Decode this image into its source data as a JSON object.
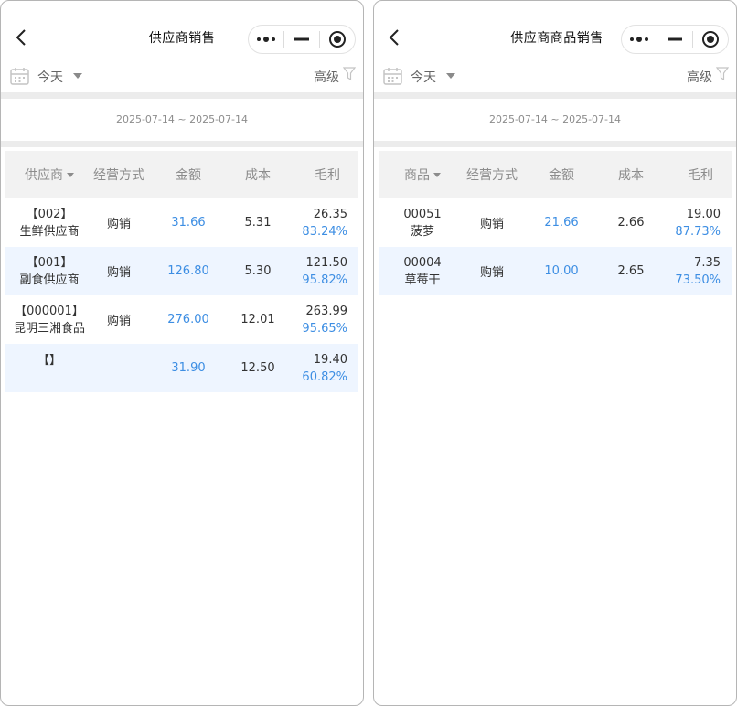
{
  "left": {
    "title": "供应商销售",
    "filter": {
      "period": "今天",
      "advanced": "高级"
    },
    "date_range": "2025-07-14 ~ 2025-07-14",
    "headers": [
      "供应商",
      "经营方式",
      "金额",
      "成本",
      "毛利"
    ],
    "rows": [
      {
        "code": "【002】",
        "name": "生鲜供应商",
        "mode": "购销",
        "amount": "31.66",
        "cost": "5.31",
        "profit": "26.35",
        "margin": "83.24%"
      },
      {
        "code": "【001】",
        "name": "副食供应商",
        "mode": "购销",
        "amount": "126.80",
        "cost": "5.30",
        "profit": "121.50",
        "margin": "95.82%"
      },
      {
        "code": "【000001】",
        "name": "昆明三湘食品",
        "mode": "购销",
        "amount": "276.00",
        "cost": "12.01",
        "profit": "263.99",
        "margin": "95.65%"
      },
      {
        "code": "【】",
        "name": "",
        "mode": "",
        "amount": "31.90",
        "cost": "12.50",
        "profit": "19.40",
        "margin": "60.82%"
      }
    ]
  },
  "right": {
    "title": "供应商商品销售",
    "filter": {
      "period": "今天",
      "advanced": "高级"
    },
    "date_range": "2025-07-14 ~ 2025-07-14",
    "headers": [
      "商品",
      "经营方式",
      "金额",
      "成本",
      "毛利"
    ],
    "rows": [
      {
        "code": "00051",
        "name": "菠萝",
        "mode": "购销",
        "amount": "21.66",
        "cost": "2.66",
        "profit": "19.00",
        "margin": "87.73%"
      },
      {
        "code": "00004",
        "name": "草莓干",
        "mode": "购销",
        "amount": "10.00",
        "cost": "2.65",
        "profit": "7.35",
        "margin": "73.50%"
      }
    ]
  },
  "colors": {
    "accent_blue": "#3d8ee3",
    "row_highlight": "#eef5ff",
    "header_bg": "#f2f2f2"
  },
  "icons": [
    "back-arrow-icon",
    "more-dots-icon",
    "minimize-icon",
    "close-target-icon",
    "calendar-icon",
    "dropdown-caret-icon",
    "filter-funnel-icon",
    "sort-caret-icon"
  ]
}
